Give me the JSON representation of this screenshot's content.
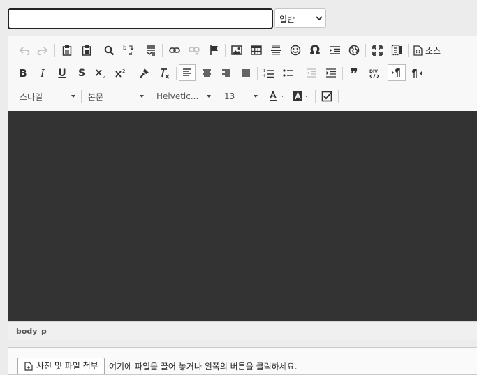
{
  "form": {
    "title_value": "",
    "category_selected": "일반"
  },
  "toolbar": {
    "source_label": "소스",
    "style_combo": "스타일",
    "format_combo": "본문",
    "font_combo": "Helvetic...",
    "size_combo": "13",
    "bold_label": "B",
    "italic_label": "I",
    "underline_label": "U",
    "strike_label": "S"
  },
  "elements_path": [
    "body",
    "p"
  ],
  "upload": {
    "button_label": "사진 및 파일 첨부",
    "hint": "여기에 파일을 끌어 놓거나 왼쪽의 버튼을 클릭하세요."
  }
}
